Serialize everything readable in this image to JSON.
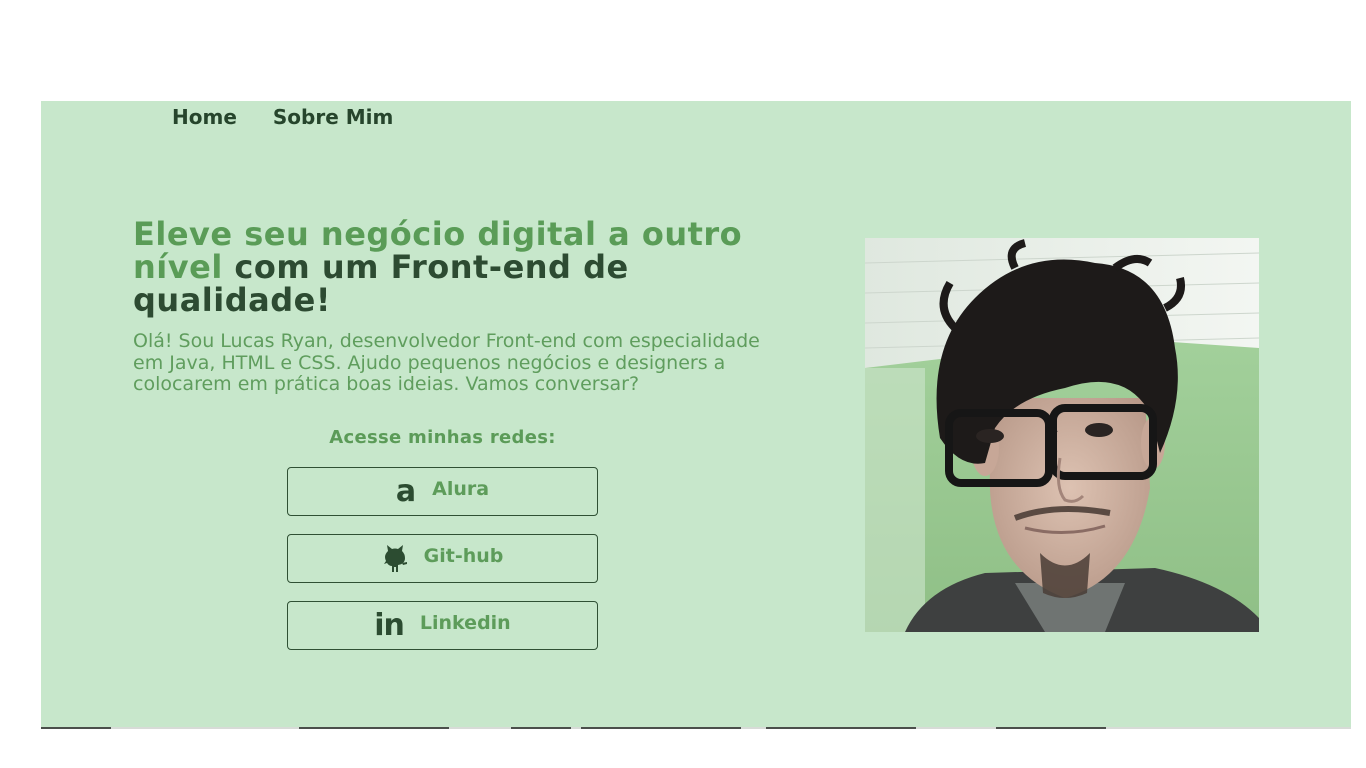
{
  "nav": {
    "items": [
      {
        "label": "Home"
      },
      {
        "label": "Sobre Mim"
      }
    ]
  },
  "hero": {
    "headline_highlight": "Eleve seu negócio digital a outro nível",
    "headline_rest": "com um Front-end de qualidade!",
    "intro": "Olá! Sou Lucas Ryan, desenvolvedor Front-end com especialidade em Java, HTML e CSS. Ajudo pequenos negócios e designers a colocarem em prática boas ideias. Vamos conversar?"
  },
  "social": {
    "title": "Acesse minhas redes:",
    "buttons": [
      {
        "label": "Alura",
        "icon": "alura-icon",
        "icon_glyph": "a"
      },
      {
        "label": "Git-hub",
        "icon": "github-icon"
      },
      {
        "label": "Linkedin",
        "icon": "linkedin-icon",
        "icon_glyph": "in"
      }
    ]
  },
  "photo": {
    "subject": "profile-photo"
  },
  "colors": {
    "background": "#c7e7cb",
    "accent_green": "#5a9c57",
    "dark_green": "#2d4b32"
  }
}
